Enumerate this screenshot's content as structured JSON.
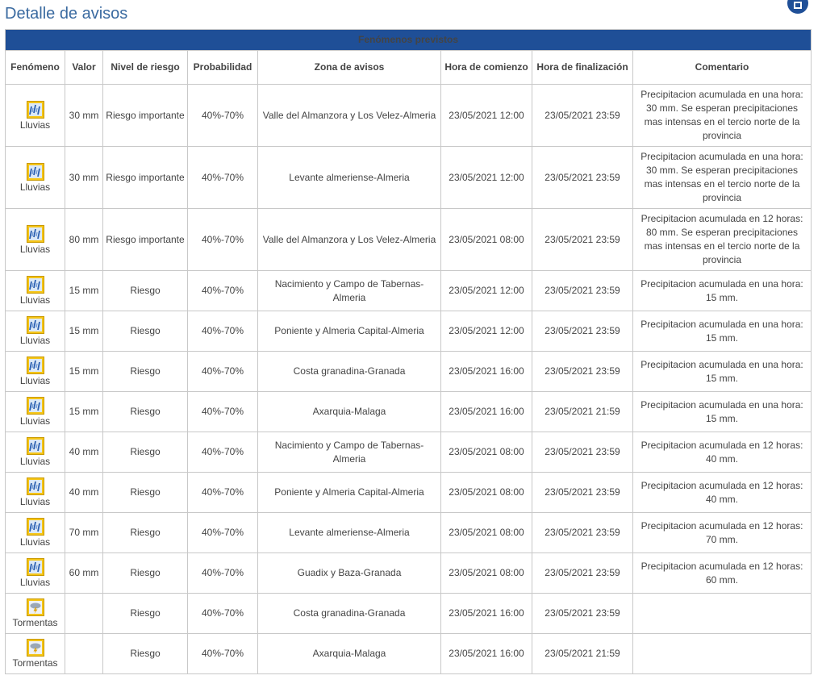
{
  "page": {
    "title": "Detalle de avisos"
  },
  "colors": {
    "title_blue": "#3a6aa0",
    "header_bar": "#1f4f97",
    "icon_yellow": "#f5c518"
  },
  "table": {
    "caption": "Fenómenos previstos",
    "headers": {
      "fenomeno": "Fenómeno",
      "valor": "Valor",
      "nivel": "Nivel de riesgo",
      "probabilidad": "Probabilidad",
      "zona": "Zona de avisos",
      "comienzo": "Hora de comienzo",
      "finalizacion": "Hora de finalización",
      "comentario": "Comentario"
    },
    "rows": [
      {
        "fenomeno": "Lluvias",
        "icon": "rain-icon",
        "valor": "30 mm",
        "nivel": "Riesgo importante",
        "probabilidad": "40%-70%",
        "zona": "Valle del Almanzora y Los Velez-Almeria",
        "comienzo": "23/05/2021 12:00",
        "fin": "23/05/2021 23:59",
        "comentario": "Precipitacion acumulada en una hora: 30 mm. Se esperan precipitaciones mas intensas en el tercio norte de la provincia"
      },
      {
        "fenomeno": "Lluvias",
        "icon": "rain-icon",
        "valor": "30 mm",
        "nivel": "Riesgo importante",
        "probabilidad": "40%-70%",
        "zona": "Levante almeriense-Almeria",
        "comienzo": "23/05/2021 12:00",
        "fin": "23/05/2021 23:59",
        "comentario": "Precipitacion acumulada en una hora: 30 mm. Se esperan precipitaciones mas intensas en el tercio norte de la provincia"
      },
      {
        "fenomeno": "Lluvias",
        "icon": "rain-icon",
        "valor": "80 mm",
        "nivel": "Riesgo importante",
        "probabilidad": "40%-70%",
        "zona": "Valle del Almanzora y Los Velez-Almeria",
        "comienzo": "23/05/2021 08:00",
        "fin": "23/05/2021 23:59",
        "comentario": "Precipitacion acumulada en 12 horas: 80 mm. Se esperan precipitaciones mas intensas en el tercio norte de la provincia"
      },
      {
        "fenomeno": "Lluvias",
        "icon": "rain-icon",
        "valor": "15 mm",
        "nivel": "Riesgo",
        "probabilidad": "40%-70%",
        "zona": "Nacimiento y Campo de Tabernas-Almeria",
        "comienzo": "23/05/2021 12:00",
        "fin": "23/05/2021 23:59",
        "comentario": "Precipitacion acumulada en una hora: 15 mm."
      },
      {
        "fenomeno": "Lluvias",
        "icon": "rain-icon",
        "valor": "15 mm",
        "nivel": "Riesgo",
        "probabilidad": "40%-70%",
        "zona": "Poniente y Almeria Capital-Almeria",
        "comienzo": "23/05/2021 12:00",
        "fin": "23/05/2021 23:59",
        "comentario": "Precipitacion acumulada en una hora: 15 mm."
      },
      {
        "fenomeno": "Lluvias",
        "icon": "rain-icon",
        "valor": "15 mm",
        "nivel": "Riesgo",
        "probabilidad": "40%-70%",
        "zona": "Costa granadina-Granada",
        "comienzo": "23/05/2021 16:00",
        "fin": "23/05/2021 23:59",
        "comentario": "Precipitacion acumulada en una hora: 15 mm."
      },
      {
        "fenomeno": "Lluvias",
        "icon": "rain-icon",
        "valor": "15 mm",
        "nivel": "Riesgo",
        "probabilidad": "40%-70%",
        "zona": "Axarquia-Malaga",
        "comienzo": "23/05/2021 16:00",
        "fin": "23/05/2021 21:59",
        "comentario": "Precipitacion acumulada en una hora: 15 mm."
      },
      {
        "fenomeno": "Lluvias",
        "icon": "rain-icon",
        "valor": "40 mm",
        "nivel": "Riesgo",
        "probabilidad": "40%-70%",
        "zona": "Nacimiento y Campo de Tabernas-Almeria",
        "comienzo": "23/05/2021 08:00",
        "fin": "23/05/2021 23:59",
        "comentario": "Precipitacion acumulada en 12 horas: 40 mm."
      },
      {
        "fenomeno": "Lluvias",
        "icon": "rain-icon",
        "valor": "40 mm",
        "nivel": "Riesgo",
        "probabilidad": "40%-70%",
        "zona": "Poniente y Almeria Capital-Almeria",
        "comienzo": "23/05/2021 08:00",
        "fin": "23/05/2021 23:59",
        "comentario": "Precipitacion acumulada en 12 horas: 40 mm."
      },
      {
        "fenomeno": "Lluvias",
        "icon": "rain-icon",
        "valor": "70 mm",
        "nivel": "Riesgo",
        "probabilidad": "40%-70%",
        "zona": "Levante almeriense-Almeria",
        "comienzo": "23/05/2021 08:00",
        "fin": "23/05/2021 23:59",
        "comentario": "Precipitacion acumulada en 12 horas: 70 mm."
      },
      {
        "fenomeno": "Lluvias",
        "icon": "rain-icon",
        "valor": "60 mm",
        "nivel": "Riesgo",
        "probabilidad": "40%-70%",
        "zona": "Guadix y Baza-Granada",
        "comienzo": "23/05/2021 08:00",
        "fin": "23/05/2021 23:59",
        "comentario": "Precipitacion acumulada en 12 horas: 60 mm."
      },
      {
        "fenomeno": "Tormentas",
        "icon": "storm-icon",
        "valor": "",
        "nivel": "Riesgo",
        "probabilidad": "40%-70%",
        "zona": "Costa granadina-Granada",
        "comienzo": "23/05/2021 16:00",
        "fin": "23/05/2021 23:59",
        "comentario": ""
      },
      {
        "fenomeno": "Tormentas",
        "icon": "storm-icon",
        "valor": "",
        "nivel": "Riesgo",
        "probabilidad": "40%-70%",
        "zona": "Axarquia-Malaga",
        "comienzo": "23/05/2021 16:00",
        "fin": "23/05/2021 21:59",
        "comentario": ""
      }
    ]
  }
}
